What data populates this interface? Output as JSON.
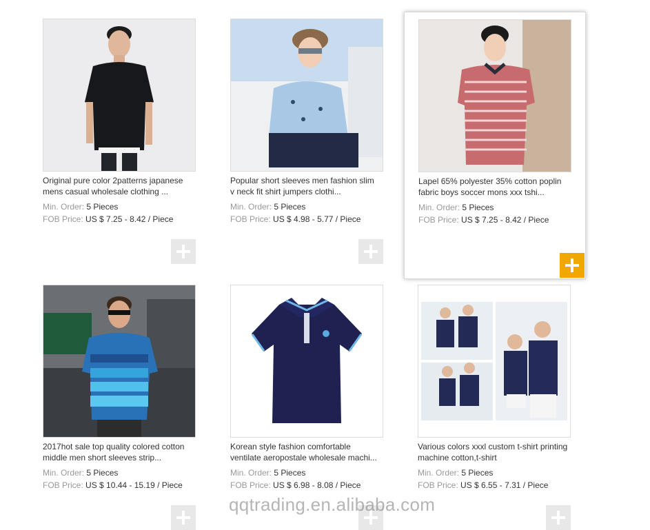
{
  "products": [
    {
      "title_line1": "Original pure color 2patterns japanese",
      "title_line2": "mens casual wholesale clothing ...",
      "min_order_label": "Min. Order:",
      "min_order": "5 Pieces",
      "fob_label": "FOB Price:",
      "fob_price": "US $ 7.25 - 8.42 / Piece",
      "image": "model-black-polo"
    },
    {
      "title_line1": "Popular short sleeves men fashion slim",
      "title_line2": "v neck fit shirt jumpers clothi...",
      "min_order_label": "Min. Order:",
      "min_order": "5 Pieces",
      "fob_label": "FOB Price:",
      "fob_price": "US $ 4.98 - 5.77 / Piece",
      "image": "model-light-blue-print-shirt"
    },
    {
      "title_line1": "Lapel 65% polyester 35% cotton poplin",
      "title_line2": "fabric boys soccer mons xxx tshi...",
      "min_order_label": "Min. Order:",
      "min_order": "5 Pieces",
      "fob_label": "FOB Price:",
      "fob_price": "US $ 7.25 - 8.42 / Piece",
      "image": "model-red-striped-polo"
    },
    {
      "title_line1": "2017hot sale top quality colored cotton",
      "title_line2": "middle men short sleeves strip...",
      "min_order_label": "Min. Order:",
      "min_order": "5 Pieces",
      "fob_label": "FOB Price:",
      "fob_price": "US $ 10.44 - 15.19 / Piece",
      "image": "model-blue-striped-polo-street"
    },
    {
      "title_line1": "Korean style fashion comfortable",
      "title_line2": "ventilate aeropostale wholesale machi...",
      "min_order_label": "Min. Order:",
      "min_order": "5 Pieces",
      "fob_label": "FOB Price:",
      "fob_price": "US $ 6.98 - 8.08 / Piece",
      "image": "navy-polo-flat"
    },
    {
      "title_line1": "Various colors xxxl custom t-shirt printing",
      "title_line2": "machine cotton,t-shirt",
      "min_order_label": "Min. Order:",
      "min_order": "5 Pieces",
      "fob_label": "FOB Price:",
      "fob_price": "US $ 6.55 - 7.31 / Piece",
      "image": "couple-navy-polos"
    }
  ],
  "watermark": "qqtrading.en.alibaba.com",
  "colors": {
    "accent": "#f0a800",
    "add_idle": "#e8e8e8",
    "label": "#999999",
    "text": "#333333"
  }
}
